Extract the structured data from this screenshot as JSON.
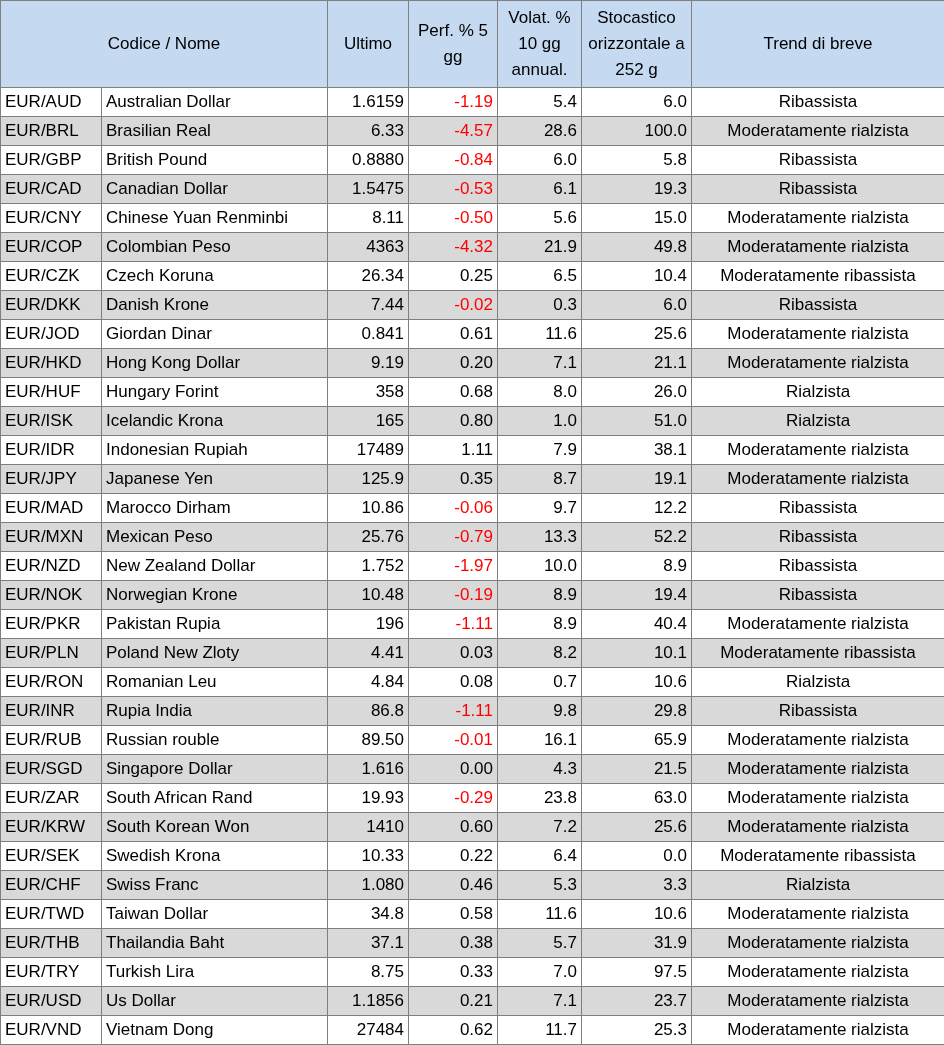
{
  "table": {
    "columns": [
      "Codice / Nome",
      "Ultimo",
      "Perf. % 5 gg",
      "Volat. % 10 gg annual.",
      "Stocastico orizzontale a 252 g",
      "Trend di breve"
    ],
    "rows": [
      {
        "code": "EUR/AUD",
        "name": "Australian Dollar",
        "last": "1.6159",
        "perf": "-1.19",
        "perf_negative": true,
        "vol": "5.4",
        "stoch": "6.0",
        "trend": "Ribassista",
        "shaded": false
      },
      {
        "code": "EUR/BRL",
        "name": "Brasilian Real",
        "last": "6.33",
        "perf": "-4.57",
        "perf_negative": true,
        "vol": "28.6",
        "stoch": "100.0",
        "trend": "Moderatamente rialzista",
        "shaded": true
      },
      {
        "code": "EUR/GBP",
        "name": "British Pound",
        "last": "0.8880",
        "perf": "-0.84",
        "perf_negative": true,
        "vol": "6.0",
        "stoch": "5.8",
        "trend": "Ribassista",
        "shaded": false
      },
      {
        "code": "EUR/CAD",
        "name": "Canadian Dollar",
        "last": "1.5475",
        "perf": "-0.53",
        "perf_negative": true,
        "vol": "6.1",
        "stoch": "19.3",
        "trend": "Ribassista",
        "shaded": true
      },
      {
        "code": "EUR/CNY",
        "name": "Chinese Yuan Renminbi",
        "last": "8.11",
        "perf": "-0.50",
        "perf_negative": true,
        "vol": "5.6",
        "stoch": "15.0",
        "trend": "Moderatamente rialzista",
        "shaded": false
      },
      {
        "code": "EUR/COP",
        "name": "Colombian Peso",
        "last": "4363",
        "perf": "-4.32",
        "perf_negative": true,
        "vol": "21.9",
        "stoch": "49.8",
        "trend": "Moderatamente rialzista",
        "shaded": true
      },
      {
        "code": "EUR/CZK",
        "name": "Czech Koruna",
        "last": "26.34",
        "perf": "0.25",
        "perf_negative": false,
        "vol": "6.5",
        "stoch": "10.4",
        "trend": "Moderatamente ribassista",
        "shaded": false
      },
      {
        "code": "EUR/DKK",
        "name": "Danish Krone",
        "last": "7.44",
        "perf": "-0.02",
        "perf_negative": true,
        "vol": "0.3",
        "stoch": "6.0",
        "trend": "Ribassista",
        "shaded": true
      },
      {
        "code": "EUR/JOD",
        "name": "Giordan Dinar",
        "last": "0.841",
        "perf": "0.61",
        "perf_negative": false,
        "vol": "11.6",
        "stoch": "25.6",
        "trend": "Moderatamente rialzista",
        "shaded": false
      },
      {
        "code": "EUR/HKD",
        "name": "Hong Kong Dollar",
        "last": "9.19",
        "perf": "0.20",
        "perf_negative": false,
        "vol": "7.1",
        "stoch": "21.1",
        "trend": "Moderatamente rialzista",
        "shaded": true
      },
      {
        "code": "EUR/HUF",
        "name": "Hungary Forint",
        "last": "358",
        "perf": "0.68",
        "perf_negative": false,
        "vol": "8.0",
        "stoch": "26.0",
        "trend": "Rialzista",
        "shaded": false
      },
      {
        "code": "EUR/ISK",
        "name": "Icelandic Krona",
        "last": "165",
        "perf": "0.80",
        "perf_negative": false,
        "vol": "1.0",
        "stoch": "51.0",
        "trend": "Rialzista",
        "shaded": true
      },
      {
        "code": "EUR/IDR",
        "name": "Indonesian Rupiah",
        "last": "17489",
        "perf": "1.11",
        "perf_negative": false,
        "vol": "7.9",
        "stoch": "38.1",
        "trend": "Moderatamente rialzista",
        "shaded": false
      },
      {
        "code": "EUR/JPY",
        "name": "Japanese Yen",
        "last": "125.9",
        "perf": "0.35",
        "perf_negative": false,
        "vol": "8.7",
        "stoch": "19.1",
        "trend": "Moderatamente rialzista",
        "shaded": true
      },
      {
        "code": "EUR/MAD",
        "name": "Marocco Dirham",
        "last": "10.86",
        "perf": "-0.06",
        "perf_negative": true,
        "vol": "9.7",
        "stoch": "12.2",
        "trend": "Ribassista",
        "shaded": false
      },
      {
        "code": "EUR/MXN",
        "name": "Mexican Peso",
        "last": "25.76",
        "perf": "-0.79",
        "perf_negative": true,
        "vol": "13.3",
        "stoch": "52.2",
        "trend": "Ribassista",
        "shaded": true
      },
      {
        "code": "EUR/NZD",
        "name": "New Zealand Dollar",
        "last": "1.752",
        "perf": "-1.97",
        "perf_negative": true,
        "vol": "10.0",
        "stoch": "8.9",
        "trend": "Ribassista",
        "shaded": false
      },
      {
        "code": "EUR/NOK",
        "name": "Norwegian Krone",
        "last": "10.48",
        "perf": "-0.19",
        "perf_negative": true,
        "vol": "8.9",
        "stoch": "19.4",
        "trend": "Ribassista",
        "shaded": true
      },
      {
        "code": "EUR/PKR",
        "name": "Pakistan Rupia",
        "last": "196",
        "perf": "-1.11",
        "perf_negative": true,
        "vol": "8.9",
        "stoch": "40.4",
        "trend": "Moderatamente rialzista",
        "shaded": false
      },
      {
        "code": "EUR/PLN",
        "name": "Poland New Zloty",
        "last": "4.41",
        "perf": "0.03",
        "perf_negative": false,
        "vol": "8.2",
        "stoch": "10.1",
        "trend": "Moderatamente ribassista",
        "shaded": true
      },
      {
        "code": "EUR/RON",
        "name": "Romanian Leu",
        "last": "4.84",
        "perf": "0.08",
        "perf_negative": false,
        "vol": "0.7",
        "stoch": "10.6",
        "trend": "Rialzista",
        "shaded": false
      },
      {
        "code": "EUR/INR",
        "name": "Rupia India",
        "last": "86.8",
        "perf": "-1.11",
        "perf_negative": true,
        "vol": "9.8",
        "stoch": "29.8",
        "trend": "Ribassista",
        "shaded": true
      },
      {
        "code": "EUR/RUB",
        "name": "Russian rouble",
        "last": "89.50",
        "perf": "-0.01",
        "perf_negative": true,
        "vol": "16.1",
        "stoch": "65.9",
        "trend": "Moderatamente rialzista",
        "shaded": false
      },
      {
        "code": "EUR/SGD",
        "name": "Singapore Dollar",
        "last": "1.616",
        "perf": "0.00",
        "perf_negative": false,
        "vol": "4.3",
        "stoch": "21.5",
        "trend": "Moderatamente rialzista",
        "shaded": true
      },
      {
        "code": "EUR/ZAR",
        "name": "South African Rand",
        "last": "19.93",
        "perf": "-0.29",
        "perf_negative": true,
        "vol": "23.8",
        "stoch": "63.0",
        "trend": "Moderatamente rialzista",
        "shaded": false
      },
      {
        "code": "EUR/KRW",
        "name": "South Korean Won",
        "last": "1410",
        "perf": "0.60",
        "perf_negative": false,
        "vol": "7.2",
        "stoch": "25.6",
        "trend": "Moderatamente rialzista",
        "shaded": true
      },
      {
        "code": "EUR/SEK",
        "name": "Swedish Krona",
        "last": "10.33",
        "perf": "0.22",
        "perf_negative": false,
        "vol": "6.4",
        "stoch": "0.0",
        "trend": "Moderatamente ribassista",
        "shaded": false
      },
      {
        "code": "EUR/CHF",
        "name": "Swiss Franc",
        "last": "1.080",
        "perf": "0.46",
        "perf_negative": false,
        "vol": "5.3",
        "stoch": "3.3",
        "trend": "Rialzista",
        "shaded": true
      },
      {
        "code": "EUR/TWD",
        "name": "Taiwan Dollar",
        "last": "34.8",
        "perf": "0.58",
        "perf_negative": false,
        "vol": "11.6",
        "stoch": "10.6",
        "trend": "Moderatamente rialzista",
        "shaded": false
      },
      {
        "code": "EUR/THB",
        "name": "Thailandia Baht",
        "last": "37.1",
        "perf": "0.38",
        "perf_negative": false,
        "vol": "5.7",
        "stoch": "31.9",
        "trend": "Moderatamente rialzista",
        "shaded": true
      },
      {
        "code": "EUR/TRY",
        "name": "Turkish Lira",
        "last": "8.75",
        "perf": "0.33",
        "perf_negative": false,
        "vol": "7.0",
        "stoch": "97.5",
        "trend": "Moderatamente rialzista",
        "shaded": false
      },
      {
        "code": "EUR/USD",
        "name": "Us Dollar",
        "last": "1.1856",
        "perf": "0.21",
        "perf_negative": false,
        "vol": "7.1",
        "stoch": "23.7",
        "trend": "Moderatamente rialzista",
        "shaded": true
      },
      {
        "code": "EUR/VND",
        "name": "Vietnam Dong",
        "last": "27484",
        "perf": "0.62",
        "perf_negative": false,
        "vol": "11.7",
        "stoch": "25.3",
        "trend": "Moderatamente rialzista",
        "shaded": false
      }
    ]
  }
}
